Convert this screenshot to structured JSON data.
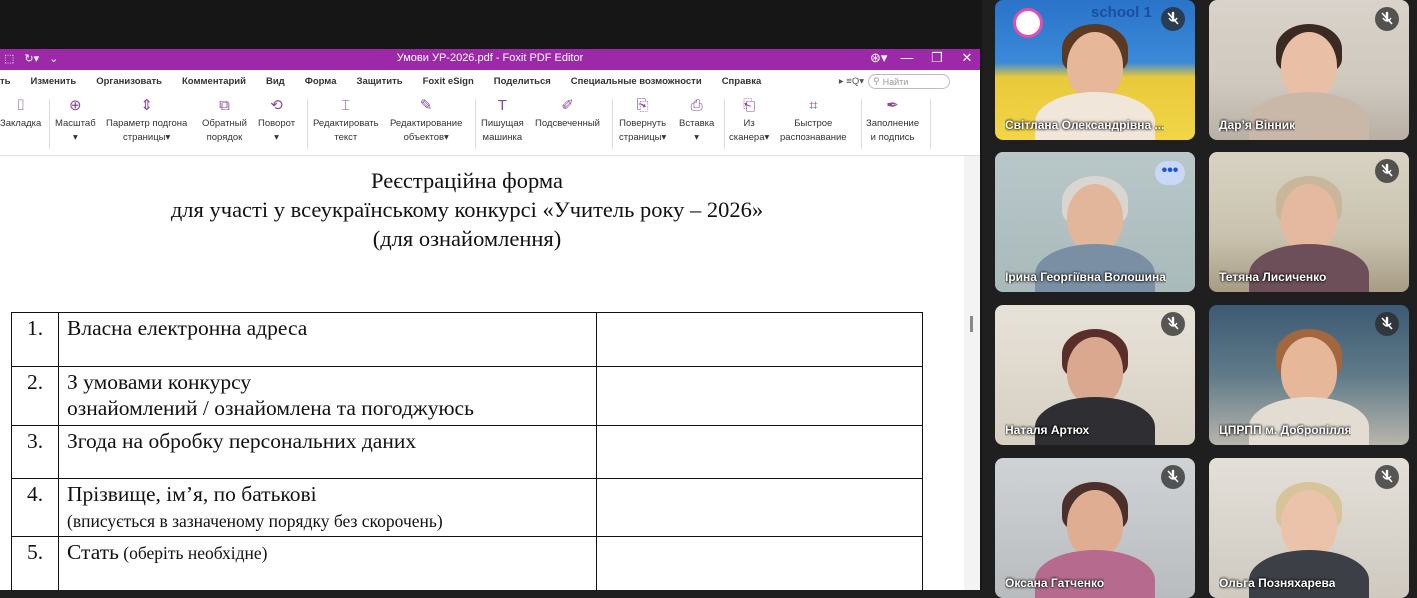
{
  "window": {
    "title": "Умови УР-2026.pdf - Foxit PDF Editor",
    "left_glyphs": [
      "⬚",
      "↻▾",
      "⌄"
    ],
    "right_controls": [
      "⊛▾",
      "—",
      "❐",
      "✕"
    ]
  },
  "menu": {
    "items": [
      "ть",
      "Изменить",
      "Организовать",
      "Комментарий",
      "Вид",
      "Форма",
      "Защитить",
      "Foxit eSign",
      "Поделиться",
      "Специальные возможности",
      "Справка"
    ],
    "search_placeholder": "Найти"
  },
  "ribbon": {
    "buttons": [
      {
        "line1": "Закладка",
        "line2": "",
        "icon": "bookmark-icon"
      },
      {
        "line1": "Масштаб",
        "line2": "▾",
        "icon": "zoom-icon"
      },
      {
        "line1": "Параметр подгона",
        "line2": "страницы▾",
        "icon": "fit-page-icon"
      },
      {
        "line1": "Обратный",
        "line2": "порядок",
        "icon": "reverse-order-icon"
      },
      {
        "line1": "Поворот",
        "line2": "▾",
        "icon": "rotate-icon"
      },
      {
        "line1": "Редактировать",
        "line2": "текст",
        "icon": "edit-text-icon"
      },
      {
        "line1": "Редактирование",
        "line2": "объектов▾",
        "icon": "edit-object-icon"
      },
      {
        "line1": "Пишущая",
        "line2": "машинка",
        "icon": "typewriter-icon"
      },
      {
        "line1": "Подсвеченный",
        "line2": "",
        "icon": "highlight-icon"
      },
      {
        "line1": "Повернуть",
        "line2": "страницы▾",
        "icon": "rotate-pages-icon"
      },
      {
        "line1": "Вставка",
        "line2": "▾",
        "icon": "insert-icon"
      },
      {
        "line1": "Из",
        "line2": "сканера▾",
        "icon": "scanner-icon"
      },
      {
        "line1": "Быстрое",
        "line2": "распознавание",
        "icon": "ocr-icon"
      },
      {
        "line1": "Заполнение",
        "line2": "и подпись",
        "icon": "fill-sign-icon"
      }
    ]
  },
  "document": {
    "title_lines": [
      "Реєстраційна форма",
      "для участі у всеукраїнському конкурсі «Учитель року – 2026»",
      "(для ознайомлення)"
    ],
    "rows": [
      {
        "num": "1.",
        "line1": "Власна електронна адреса",
        "line2": "",
        "line2_small": false
      },
      {
        "num": "2.",
        "line1": "З умовами конкурсу",
        "line2": "ознайомлений / ознайомлена та погоджуюсь",
        "line2_small": false
      },
      {
        "num": "3.",
        "line1": "Згода на обробку персональних даних",
        "line2": "",
        "line2_small": false
      },
      {
        "num": "4.",
        "line1": "Прізвище, ім’я, по батькові",
        "line2": "(вписується в зазначеному порядку без скорочень)",
        "line2_small": true
      },
      {
        "num": "5.",
        "line1": "Стать",
        "line1_extra": " (оберіть необхідне)",
        "line2": "",
        "line2_small": false
      }
    ]
  },
  "participants": [
    {
      "name": "Світлана Олександрівна ...",
      "muted": true,
      "overlay": "school 1"
    },
    {
      "name": "Дар’я Вінник",
      "muted": true
    },
    {
      "name": "Ірина Георгіївна Волошина",
      "muted": false,
      "active": true,
      "more": "•••"
    },
    {
      "name": "Тетяна Лисиченко",
      "muted": true
    },
    {
      "name": "Наталя Артюх",
      "muted": true
    },
    {
      "name": "ЦПРПП м. Добропілля",
      "muted": true
    },
    {
      "name": "Оксана Гатченко",
      "muted": true
    },
    {
      "name": "Ольга Позняхарева",
      "muted": true
    }
  ],
  "colors": {
    "titlebar": "#9c2aa8",
    "accent_icon": "#8a4a9a",
    "active_outline": "#9fb8f0"
  }
}
